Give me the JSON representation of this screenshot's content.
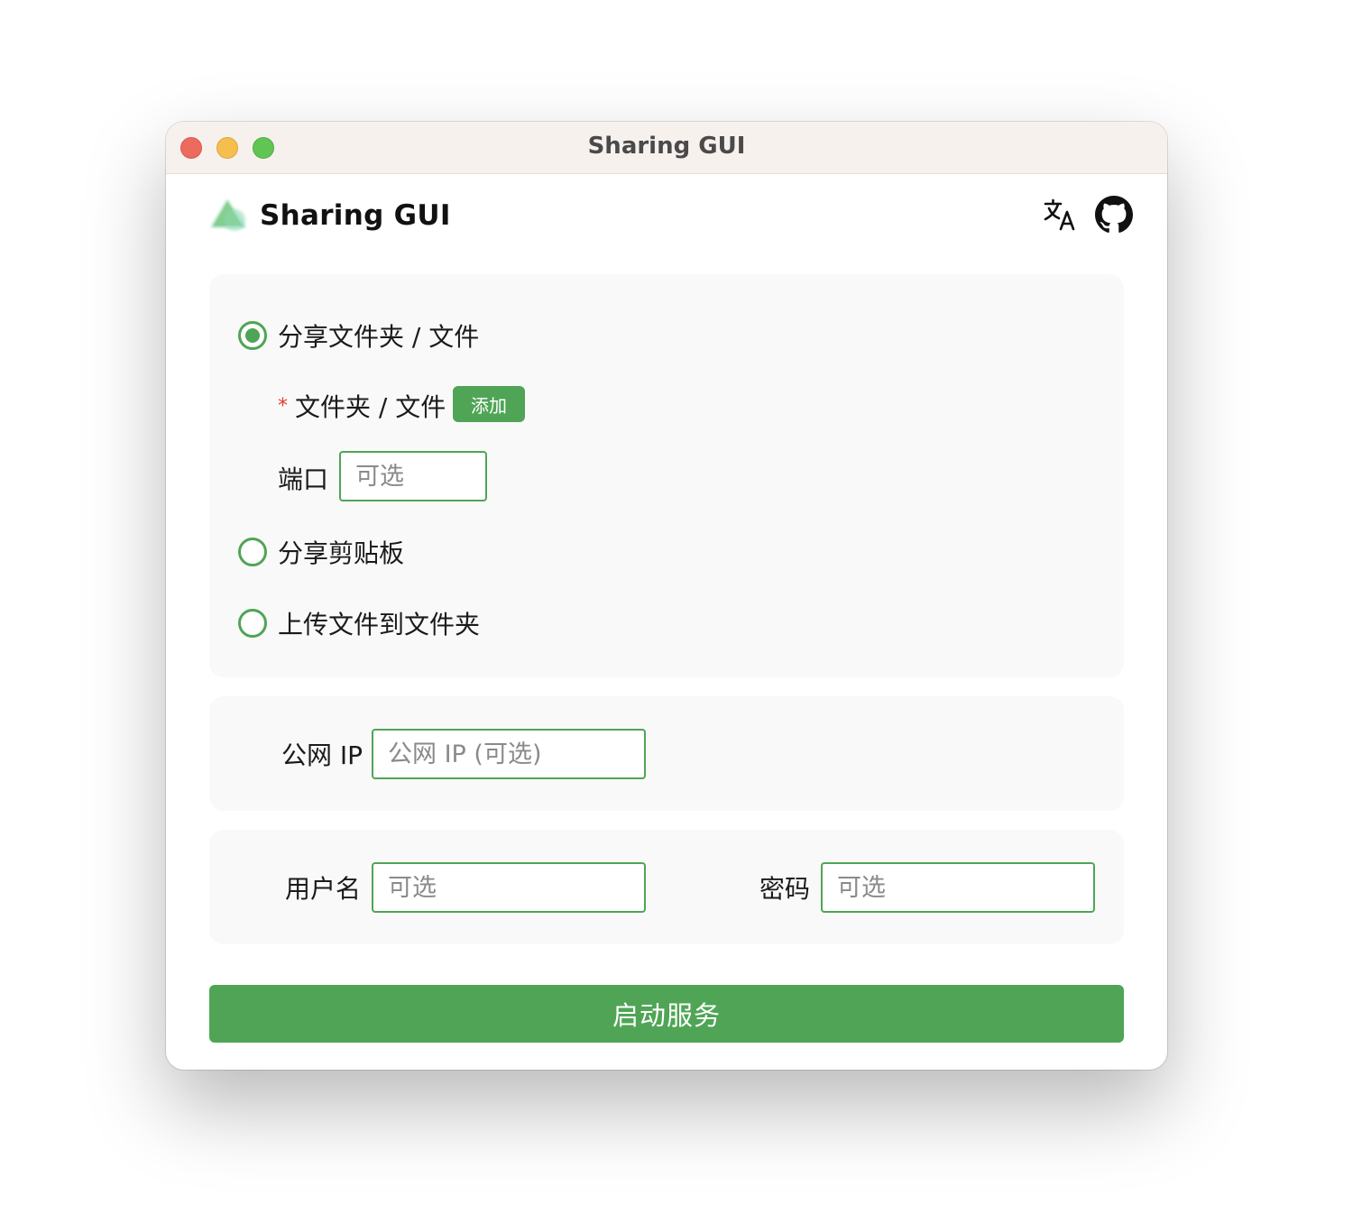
{
  "window": {
    "title": "Sharing GUI"
  },
  "header": {
    "app_name": "Sharing GUI",
    "icons": [
      "translate-icon",
      "github-icon"
    ]
  },
  "share_mode": {
    "options": [
      {
        "label": "分享文件夹 / 文件",
        "checked": true
      },
      {
        "label": "分享剪贴板",
        "checked": false
      },
      {
        "label": "上传文件到文件夹",
        "checked": false
      }
    ],
    "files_label": "文件夹 / 文件",
    "required_mark": "*",
    "add_button": "添加",
    "port_label": "端口",
    "port_placeholder": "可选"
  },
  "network": {
    "public_ip_label": "公网 IP",
    "public_ip_placeholder": "公网 IP (可选)"
  },
  "auth": {
    "username_label": "用户名",
    "username_placeholder": "可选",
    "password_label": "密码",
    "password_placeholder": "可选"
  },
  "actions": {
    "start_button": "启动服务"
  },
  "colors": {
    "accent": "#4fa555",
    "card_bg": "#f9f9f9",
    "titlebar_bg": "#f7f1ee",
    "required": "#e53935"
  }
}
